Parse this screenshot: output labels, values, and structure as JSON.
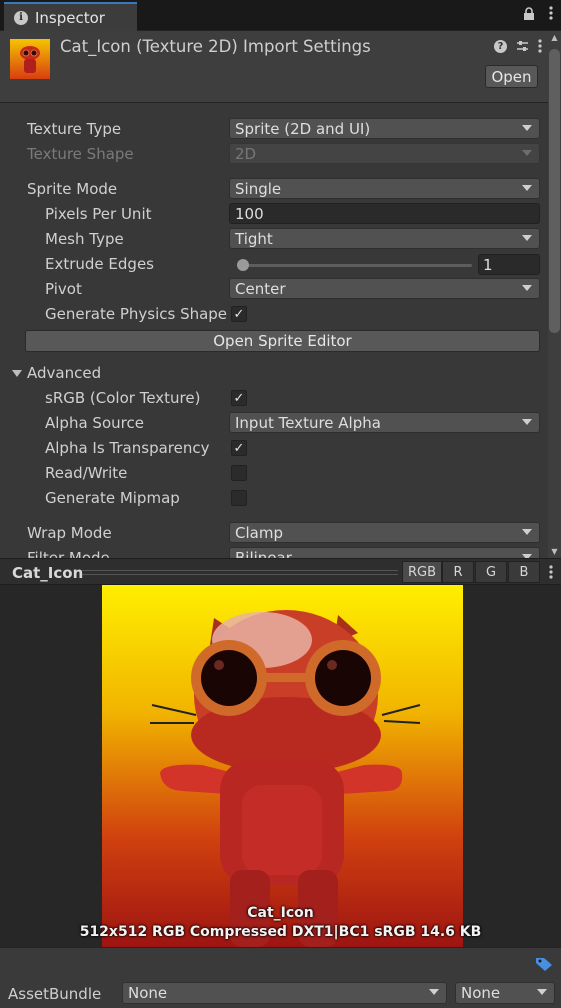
{
  "tab": {
    "title": "Inspector"
  },
  "header": {
    "title": "Cat_Icon (Texture 2D) Import Settings",
    "open_label": "Open"
  },
  "settings": {
    "texture_type": {
      "label": "Texture Type",
      "value": "Sprite (2D and UI)"
    },
    "texture_shape": {
      "label": "Texture Shape",
      "value": "2D"
    },
    "sprite_mode": {
      "label": "Sprite Mode",
      "value": "Single"
    },
    "pixels_per_unit": {
      "label": "Pixels Per Unit",
      "value": "100"
    },
    "mesh_type": {
      "label": "Mesh Type",
      "value": "Tight"
    },
    "extrude_edges": {
      "label": "Extrude Edges",
      "value": "1"
    },
    "pivot": {
      "label": "Pivot",
      "value": "Center"
    },
    "generate_physics_shape": {
      "label": "Generate Physics Shape",
      "checked": true
    },
    "open_sprite_editor": "Open Sprite Editor",
    "advanced": {
      "label": "Advanced"
    },
    "srgb": {
      "label": "sRGB (Color Texture)",
      "checked": true
    },
    "alpha_source": {
      "label": "Alpha Source",
      "value": "Input Texture Alpha"
    },
    "alpha_is_transparency": {
      "label": "Alpha Is Transparency",
      "checked": true
    },
    "read_write": {
      "label": "Read/Write",
      "checked": false
    },
    "generate_mipmap": {
      "label": "Generate Mipmap",
      "checked": false
    },
    "wrap_mode": {
      "label": "Wrap Mode",
      "value": "Clamp"
    },
    "filter_mode": {
      "label": "Filter Mode",
      "value": "Bilinear"
    }
  },
  "preview": {
    "title": "Cat_Icon",
    "channels": [
      "RGB",
      "R",
      "G",
      "B"
    ],
    "active_channel": "RGB",
    "image_name": "Cat_Icon",
    "info": "512x512  RGB Compressed DXT1|BC1 sRGB  14.6 KB"
  },
  "asset_bundle": {
    "label": "AssetBundle",
    "name": "None",
    "variant": "None"
  },
  "icons": {
    "info": "info-icon",
    "lock": "lock-icon",
    "more": "kebab-menu-icon",
    "help": "help-icon",
    "presets": "presets-icon",
    "tag": "tag-icon"
  },
  "colors": {
    "accent": "#3a79bb",
    "panel": "#383838",
    "tag_blue": "#4a8ee0"
  }
}
